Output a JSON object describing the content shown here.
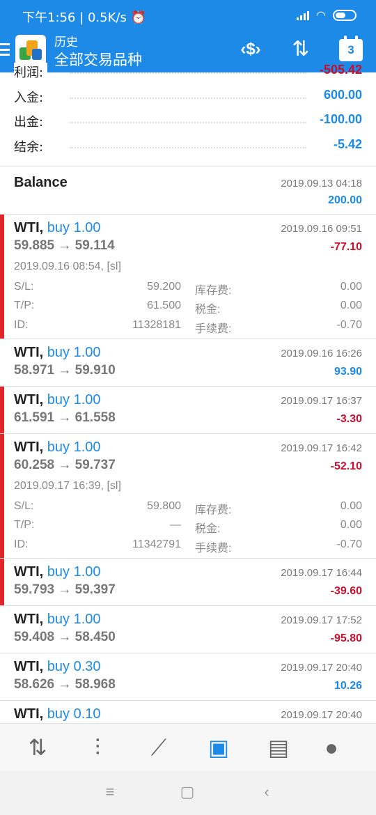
{
  "status": {
    "time": "下午1:56",
    "speed": "0.5K/s"
  },
  "header": {
    "subtitle": "历史",
    "title": "全部交易品种",
    "calendar_day": "3"
  },
  "summary": [
    {
      "label": "利润:",
      "value": "-505.42",
      "negative": true
    },
    {
      "label": "入金:",
      "value": "600.00",
      "negative": false
    },
    {
      "label": "出金:",
      "value": "-100.00",
      "negative": false
    },
    {
      "label": "结余:",
      "value": "-5.42",
      "negative": false
    }
  ],
  "balance": {
    "label": "Balance",
    "time": "2019.09.13 04:18",
    "amount": "200.00"
  },
  "deals": [
    {
      "symbol": "WTI,",
      "side": "buy 1.00",
      "prices": "59.885 → 59.114",
      "time": "2019.09.16 09:51",
      "profit": "-77.10",
      "open": "2019.09.16 08:54, [sl]",
      "sl_label": "S/L:",
      "sl": "59.200",
      "tp_label": "T/P:",
      "tp": "61.500",
      "id_label": "ID:",
      "id": "11328181",
      "swap_label": "库存费:",
      "swap": "0.00",
      "tax_label": "税金:",
      "tax": "0.00",
      "comm_label": "手续费:",
      "comm": "-0.70"
    },
    {
      "symbol": "WTI,",
      "side": "buy 1.00",
      "prices": "58.971 → 59.910",
      "time": "2019.09.16 16:26",
      "profit": "93.90"
    },
    {
      "symbol": "WTI,",
      "side": "buy 1.00",
      "prices": "61.591 → 61.558",
      "time": "2019.09.17 16:37",
      "profit": "-3.30"
    },
    {
      "symbol": "WTI,",
      "side": "buy 1.00",
      "prices": "60.258 → 59.737",
      "time": "2019.09.17 16:42",
      "profit": "-52.10",
      "open": "2019.09.17 16:39, [sl]",
      "sl_label": "S/L:",
      "sl": "59.800",
      "tp_label": "T/P:",
      "tp": "—",
      "id_label": "ID:",
      "id": "11342791",
      "swap_label": "库存费:",
      "swap": "0.00",
      "tax_label": "税金:",
      "tax": "0.00",
      "comm_label": "手续费:",
      "comm": "-0.70"
    },
    {
      "symbol": "WTI,",
      "side": "buy 1.00",
      "prices": "59.793 → 59.397",
      "time": "2019.09.17 16:44",
      "profit": "-39.60"
    },
    {
      "symbol": "WTI,",
      "side": "buy 1.00",
      "prices": "59.408 → 58.450",
      "time": "2019.09.17 17:52",
      "profit": "-95.80"
    },
    {
      "symbol": "WTI,",
      "side": "buy 0.30",
      "prices": "58.626 → 58.968",
      "time": "2019.09.17 20:40",
      "profit": "10.26"
    },
    {
      "symbol": "WTI,",
      "side": "buy 0.10",
      "time": "2019.09.17 20:40"
    }
  ],
  "colors": {
    "accent": "#1c8ae6",
    "loss": "#c8102e",
    "loss_bar": "#e0252b"
  },
  "bottom_nav": [
    "quotes-icon",
    "chart-icon",
    "trade-icon",
    "history-icon",
    "news-icon",
    "chat-icon"
  ]
}
